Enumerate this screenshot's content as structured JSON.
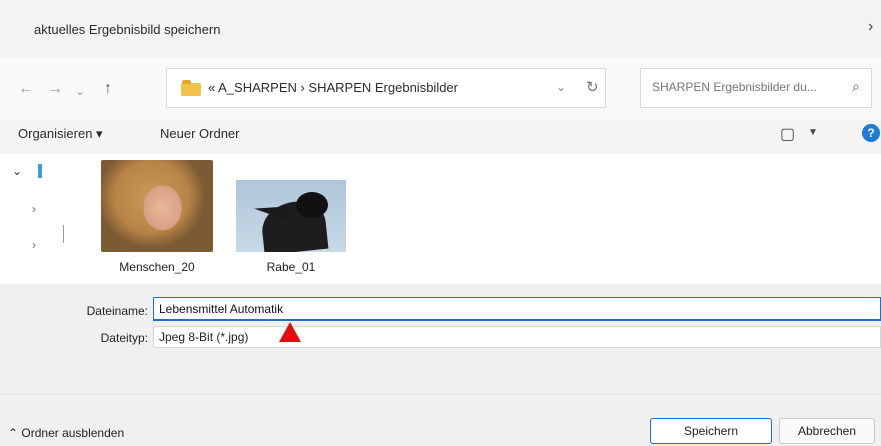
{
  "window": {
    "title": "aktuelles Ergebnisbild speichern",
    "close_glyph": "›"
  },
  "nav": {
    "back_glyph": "←",
    "forward_glyph": "→",
    "recent_glyph": "⌄",
    "up_glyph": "↑",
    "address_path": "« A_SHARPEN › SHARPEN Ergebnisbilder",
    "address_dropdown_glyph": "⌄",
    "refresh_glyph": "↻",
    "search_placeholder": "SHARPEN Ergebnisbilder du...",
    "search_glyph": "⌕"
  },
  "commandbar": {
    "organize_label": "Organisieren ▾",
    "new_folder_label": "Neuer Ordner",
    "view_glyph": "▢",
    "view_dropdown_glyph": "▼",
    "help_glyph": "?"
  },
  "tree": {
    "expanded_glyph": "⌄",
    "collapsed_glyph": "›"
  },
  "files": [
    {
      "name": "Menschen_20"
    },
    {
      "name": "Rabe_01"
    }
  ],
  "form": {
    "filename_label": "Dateiname:",
    "filename_value": "Lebensmittel Automatik",
    "filetype_label": "Dateityp:",
    "filetype_value": "Jpeg 8-Bit (*.jpg)"
  },
  "footer": {
    "hide_folders_label": "⌃  Ordner ausblenden",
    "save_label": "Speichern",
    "cancel_label": "Abbrechen"
  },
  "colors": {
    "accent": "#1f6fc4",
    "marker": "#e01010",
    "folder": "#f0c24a"
  }
}
